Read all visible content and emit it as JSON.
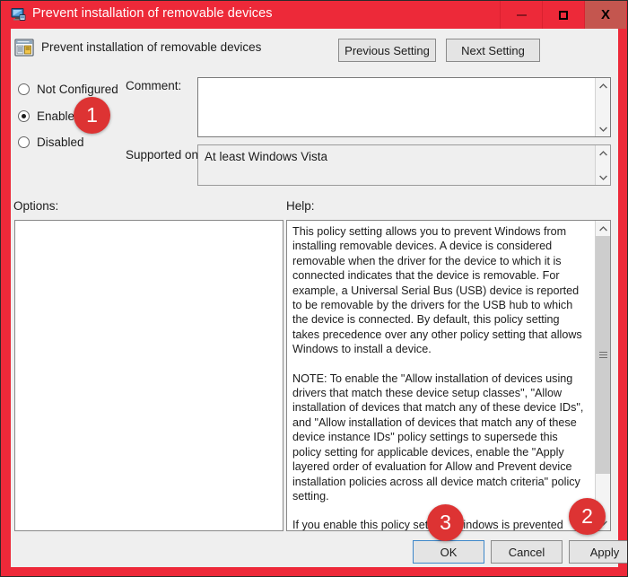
{
  "window": {
    "title": "Prevent installation of removable devices",
    "title_icon": "computer-monitor-icon",
    "minimize_label": "–",
    "maximize_label": "□",
    "close_label": "X"
  },
  "header": {
    "icon": "policy-setting-icon",
    "title": "Prevent installation of removable devices",
    "previous_setting": "Previous Setting",
    "next_setting": "Next Setting"
  },
  "state": {
    "options": [
      {
        "label": "Not Configured",
        "selected": false
      },
      {
        "label": "Enabled",
        "selected": true
      },
      {
        "label": "Disabled",
        "selected": false
      }
    ]
  },
  "comment": {
    "label": "Comment:",
    "value": ""
  },
  "supported": {
    "label": "Supported on:",
    "value": "At least Windows Vista"
  },
  "panels": {
    "options_label": "Options:",
    "options_content": "",
    "help_label": "Help:",
    "help_paragraphs": [
      "This policy setting allows you to prevent Windows from installing removable devices. A device is considered removable when the driver for the device to which it is connected indicates that the device is removable. For example, a Universal Serial Bus (USB) device is reported to be removable by the drivers for the USB hub to which the device is connected. By default, this policy setting takes precedence over any other policy setting that allows Windows to install a device.",
      "NOTE: To enable the \"Allow installation of devices using drivers that match these device setup classes\", \"Allow installation of devices that match any of these device IDs\", and \"Allow installation of devices that match any of these device instance IDs\" policy settings to supersede this policy setting for applicable devices, enable the \"Apply layered order of evaluation for Allow and Prevent device installation policies across all device match criteria\" policy setting.",
      "If you enable this policy setting, Windows is prevented from installing removable devices and existing removable devices cannot have their drivers updated. If you enable this policy"
    ]
  },
  "footer": {
    "ok": "OK",
    "cancel": "Cancel",
    "apply": "Apply"
  },
  "badges": [
    {
      "number": "1"
    },
    {
      "number": "2"
    },
    {
      "number": "3"
    }
  ],
  "colors": {
    "frame_red": "#ed2939",
    "badge_red": "#dd3333",
    "dialog_bg": "#efefef",
    "focus_blue": "#3d87c9"
  }
}
